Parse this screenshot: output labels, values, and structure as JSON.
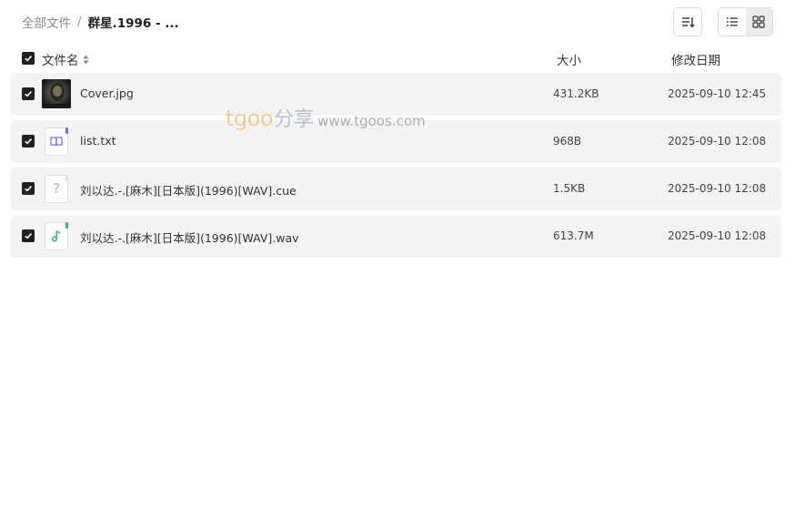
{
  "breadcrumb": {
    "root": "全部文件",
    "separator": "/",
    "current": "群星.1996 - ..."
  },
  "toolbar": {
    "sort_icon": "sort-descending-icon",
    "view_list_icon": "list-view-icon",
    "view_grid_icon": "grid-view-icon",
    "active_view": "grid"
  },
  "table": {
    "columns": {
      "name": "文件名",
      "size": "大小",
      "date": "修改日期"
    },
    "select_all": true,
    "rows": [
      {
        "name": "Cover.jpg",
        "size": "431.2KB",
        "date": "2025-09-10 12:45",
        "icon": "image-thumbnail",
        "selected": true
      },
      {
        "name": "list.txt",
        "size": "968B",
        "date": "2025-09-10 12:08",
        "icon": "book-file-icon",
        "selected": true
      },
      {
        "name": "刘以达.-.[麻木][日本版](1996)[WAV].cue",
        "size": "1.5KB",
        "date": "2025-09-10 12:08",
        "icon": "unknown-file-icon",
        "selected": true
      },
      {
        "name": "刘以达.-.[麻木][日本版](1996)[WAV].wav",
        "size": "613.7M",
        "date": "2025-09-10 12:08",
        "icon": "music-file-icon",
        "selected": true
      }
    ]
  },
  "watermark": {
    "brand": "tgoo",
    "brand_cn": "分享",
    "url": "www.tgoos.com"
  },
  "colors": {
    "row_bg": "#f3f3f3",
    "checkbox": "#202020",
    "txt_icon": "#7b6fd6",
    "audio_icon": "#2db87a",
    "unknown_icon": "#b0b0b0"
  }
}
